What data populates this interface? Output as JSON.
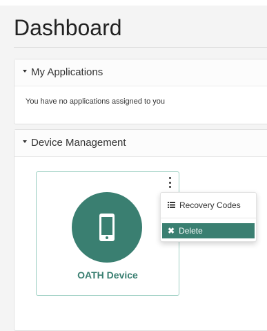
{
  "page": {
    "title": "Dashboard"
  },
  "applications": {
    "header": "My Applications",
    "empty_message": "You have no applications assigned to you"
  },
  "devices": {
    "header": "Device Management",
    "items": [
      {
        "name": "OATH Device",
        "icon": "smartphone-icon"
      }
    ]
  },
  "device_menu": {
    "items": [
      {
        "label": "Recovery Codes",
        "icon": "list-icon"
      },
      {
        "label": "Delete",
        "icon": "close-icon",
        "active": true
      }
    ]
  },
  "colors": {
    "accent": "#3a7f71",
    "accent_light": "#9ccfc2"
  }
}
